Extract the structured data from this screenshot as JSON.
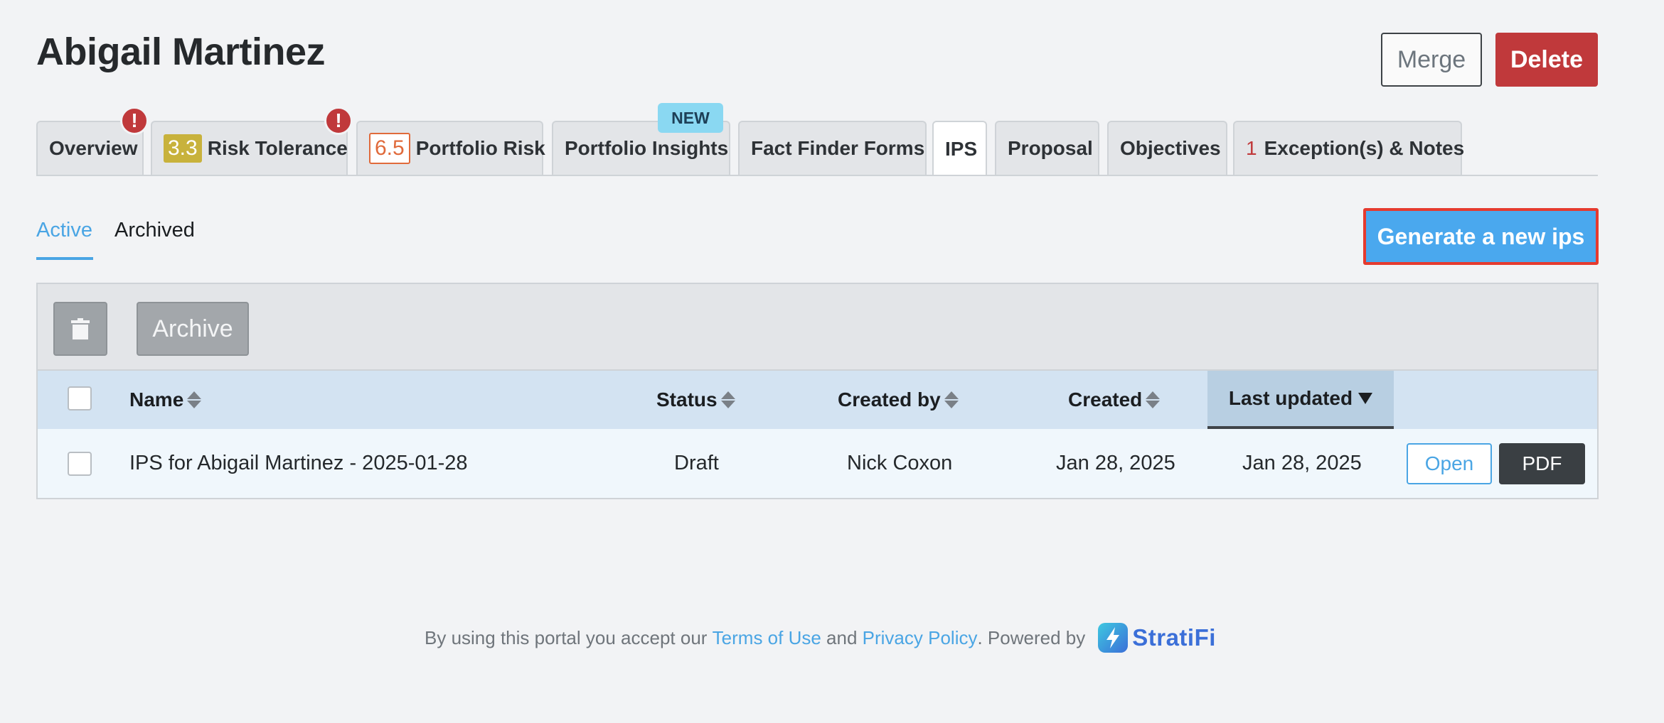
{
  "header": {
    "title": "Abigail Martinez",
    "merge_label": "Merge",
    "delete_label": "Delete"
  },
  "tabs": [
    {
      "label": "Overview",
      "alert": "!"
    },
    {
      "label": "Risk Tolerance",
      "score": "3.3",
      "alert": "!"
    },
    {
      "label": "Portfolio Risk",
      "score": "6.5"
    },
    {
      "label": "Portfolio Insights",
      "badge": "NEW"
    },
    {
      "label": "Fact Finder Forms"
    },
    {
      "label": "IPS",
      "active": true
    },
    {
      "label": "Proposal"
    },
    {
      "label": "Objectives"
    },
    {
      "label": "Exception(s) & Notes",
      "count": "1"
    }
  ],
  "subtabs": {
    "active_label": "Active",
    "archived_label": "Archived"
  },
  "generate_label": "Generate a new ips",
  "toolbar": {
    "archive_label": "Archive"
  },
  "table": {
    "columns": {
      "name": "Name",
      "status": "Status",
      "created_by": "Created by",
      "created": "Created",
      "last_updated": "Last updated"
    },
    "rows": [
      {
        "name": "IPS for Abigail Martinez - 2025-01-28",
        "status": "Draft",
        "created_by": "Nick Coxon",
        "created": "Jan 28, 2025",
        "last_updated": "Jan 28, 2025",
        "open_label": "Open",
        "pdf_label": "PDF"
      }
    ]
  },
  "footer": {
    "prefix": "By using this portal you accept our ",
    "terms": "Terms of Use",
    "and": " and ",
    "privacy": "Privacy Policy",
    "powered": ". Powered by",
    "brand": "StratiFi"
  },
  "colors": {
    "accent": "#4aa5e4",
    "danger": "#c0393b",
    "highlight_border": "#e53a2e"
  }
}
